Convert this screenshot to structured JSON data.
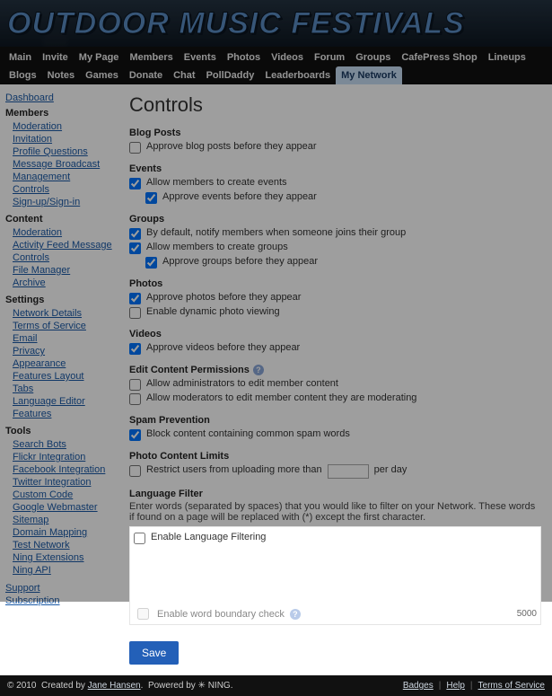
{
  "logo": "OUTDOOR MUSIC FESTIVALS",
  "nav": [
    "Main",
    "Invite",
    "My Page",
    "Members",
    "Events",
    "Photos",
    "Videos",
    "Forum",
    "Groups",
    "CafePress Shop",
    "Lineups",
    "Blogs",
    "Notes",
    "Games",
    "Donate",
    "Chat",
    "PollDaddy",
    "Leaderboards",
    "My Network"
  ],
  "nav_active": "My Network",
  "sidebar": {
    "top": [
      {
        "label": "Dashboard"
      }
    ],
    "groups": [
      {
        "title": "Members",
        "items": [
          "Moderation",
          "Invitation",
          "Profile Questions",
          "Message Broadcast",
          "Management",
          "Controls",
          "Sign-up/Sign-in"
        ]
      },
      {
        "title": "Content",
        "items": [
          "Moderation",
          "Activity Feed Message",
          "Controls",
          "File Manager",
          "Archive"
        ]
      },
      {
        "title": "Settings",
        "items": [
          "Network Details",
          "Terms of Service",
          "Email",
          "Privacy",
          "Appearance",
          "Features Layout",
          "Tabs",
          "Language Editor",
          "Features"
        ]
      },
      {
        "title": "Tools",
        "items": [
          "Search Bots",
          "Flickr Integration",
          "Facebook Integration",
          "Twitter Integration",
          "Custom Code",
          "Google Webmaster",
          "Sitemap",
          "Domain Mapping",
          "Test Network",
          "Ning Extensions",
          "Ning API"
        ]
      }
    ],
    "bottom": [
      "Support",
      "Subscription"
    ]
  },
  "title": "Controls",
  "sections": {
    "blog": {
      "h": "Blog Posts",
      "items": [
        {
          "label": "Approve blog posts before they appear",
          "checked": false
        }
      ]
    },
    "events": {
      "h": "Events",
      "items": [
        {
          "label": "Allow members to create events",
          "checked": true
        },
        {
          "label": "Approve events before they appear",
          "checked": true,
          "indent": true
        }
      ]
    },
    "groups": {
      "h": "Groups",
      "items": [
        {
          "label": "By default, notify members when someone joins their group",
          "checked": true
        },
        {
          "label": "Allow members to create groups",
          "checked": true
        },
        {
          "label": "Approve groups before they appear",
          "checked": true,
          "indent": true
        }
      ]
    },
    "photos": {
      "h": "Photos",
      "items": [
        {
          "label": "Approve photos before they appear",
          "checked": true
        },
        {
          "label": "Enable dynamic photo viewing",
          "checked": false
        }
      ]
    },
    "videos": {
      "h": "Videos",
      "items": [
        {
          "label": "Approve videos before they appear",
          "checked": true
        }
      ]
    },
    "editperm": {
      "h": "Edit Content Permissions",
      "help": true,
      "items": [
        {
          "label": "Allow administrators to edit member content",
          "checked": false
        },
        {
          "label": "Allow moderators to edit member content they are moderating",
          "checked": false
        }
      ]
    },
    "spam": {
      "h": "Spam Prevention",
      "items": [
        {
          "label": "Block content containing common spam words",
          "checked": true
        }
      ]
    },
    "photolim": {
      "h": "Photo Content Limits",
      "pre": "Restrict users from uploading more than",
      "post": "per day",
      "checked": false,
      "value": ""
    },
    "lang": {
      "h": "Language Filter",
      "desc": "Enter words (separated by spaces) that you would like to filter on your Network. These words if found on a page will be replaced with (*) except the first character.",
      "enable": "Enable Language Filtering",
      "enable_checked": false,
      "boundary": "Enable word boundary check",
      "boundary_checked": false,
      "count": "5000"
    }
  },
  "save": "Save",
  "footer": {
    "copy": "© 2010",
    "created": "Created by",
    "author": "Jane Hansen",
    "powered": "Powered by",
    "platform": "NING",
    "links": [
      "Badges",
      "Help",
      "Terms of Service"
    ]
  }
}
